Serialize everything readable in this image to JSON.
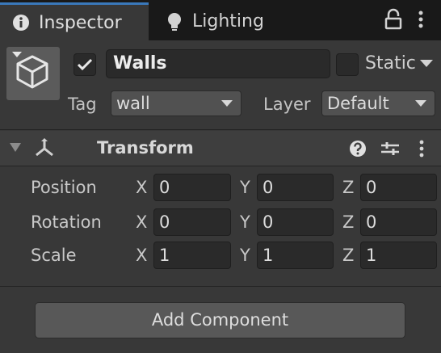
{
  "tabs": [
    {
      "label": "Inspector",
      "icon": "info-icon",
      "active": true
    },
    {
      "label": "Lighting",
      "icon": "lightbulb-icon",
      "active": false
    }
  ],
  "header": {
    "active": true,
    "name": "Walls",
    "static_label": "Static",
    "static": false,
    "tag_label": "Tag",
    "tag_value": "wall",
    "layer_label": "Layer",
    "layer_value": "Default"
  },
  "transform": {
    "title": "Transform",
    "expanded": true,
    "rows": [
      {
        "label": "Position",
        "x": "0",
        "y": "0",
        "z": "0"
      },
      {
        "label": "Rotation",
        "x": "0",
        "y": "0",
        "z": "0"
      },
      {
        "label": "Scale",
        "x": "1",
        "y": "1",
        "z": "1"
      }
    ],
    "axes": {
      "x": "X",
      "y": "Y",
      "z": "Z"
    }
  },
  "add_component_label": "Add Component",
  "colors": {
    "accent": "#3a79bb",
    "background": "#383838",
    "tabbar": "#191919",
    "field": "#2a2a2a"
  }
}
